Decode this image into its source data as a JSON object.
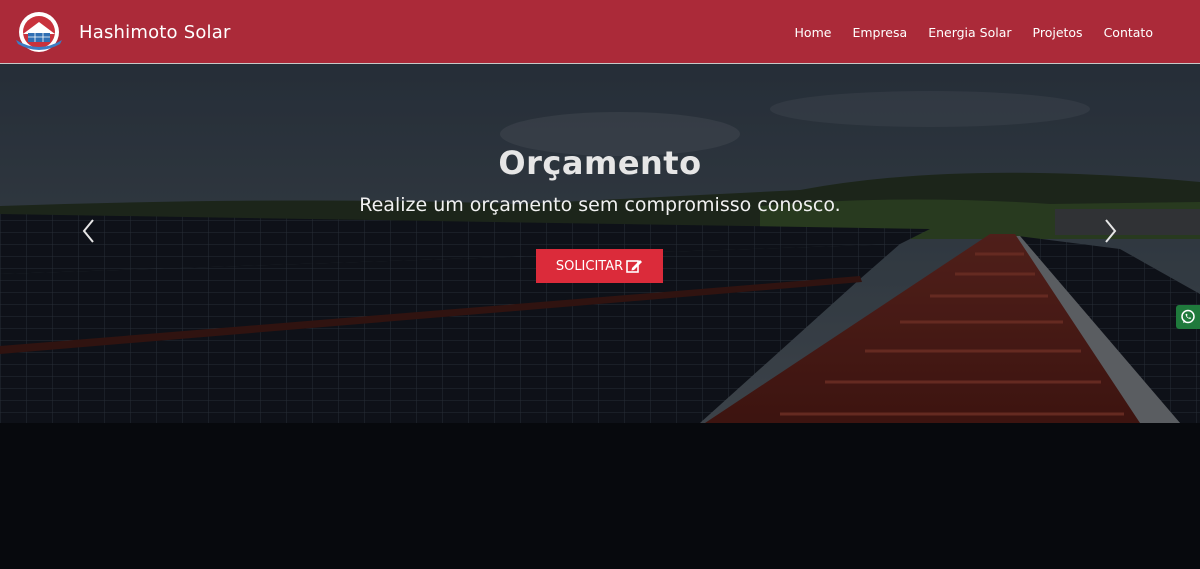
{
  "brand": {
    "name": "Hashimoto Solar",
    "logo_icon": "company-logo-icon"
  },
  "nav": {
    "items": [
      "Home",
      "Empresa",
      "Energia Solar",
      "Projetos",
      "Contato"
    ]
  },
  "hero": {
    "title": "Orçamento",
    "subtitle": "Realize um orçamento sem compromisso conosco.",
    "button_label": "SOLICITAR",
    "button_icon": "edit-icon",
    "prev_icon": "chevron-left-icon",
    "next_icon": "chevron-right-icon"
  },
  "floating": {
    "icon": "whatsapp-icon"
  },
  "colors": {
    "navbar": "#ab2a39",
    "cta": "#db2b3a",
    "background": "#07090d",
    "whatsapp": "#1f7a3c"
  }
}
